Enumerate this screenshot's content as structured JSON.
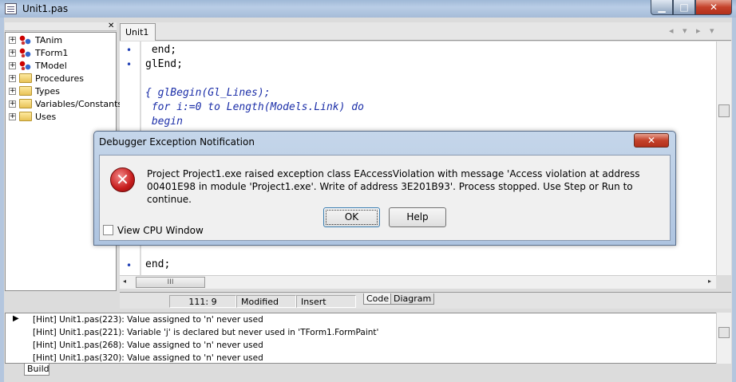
{
  "window": {
    "title": "Unit1.pas",
    "minimize": "▁",
    "maximize": "□",
    "close": "✕"
  },
  "tree": {
    "close_glyph": "✕",
    "items": [
      {
        "label": "TAnim",
        "icon": "class-icon",
        "expand": "+"
      },
      {
        "label": "TForm1",
        "icon": "class-icon",
        "expand": "+"
      },
      {
        "label": "TModel",
        "icon": "class-icon",
        "expand": "+"
      },
      {
        "label": "Procedures",
        "icon": "folder-icon",
        "expand": "+"
      },
      {
        "label": "Types",
        "icon": "folder-icon",
        "expand": "+"
      },
      {
        "label": "Variables/Constants",
        "icon": "folder-icon",
        "expand": "+"
      },
      {
        "label": "Uses",
        "icon": "folder-icon",
        "expand": "+"
      }
    ]
  },
  "editor": {
    "tab": "Unit1",
    "nav": "◂ ▾ ▸ ▾",
    "lines": [
      {
        "text": " end;",
        "comment": false,
        "dot": true
      },
      {
        "text": "glEnd;",
        "comment": false,
        "dot": true
      },
      {
        "text": "",
        "comment": false,
        "dot": false
      },
      {
        "text": "{ glBegin(Gl_Lines);",
        "comment": true,
        "dot": false
      },
      {
        "text": " for i:=0 to Length(Models.Link) do",
        "comment": true,
        "dot": false
      },
      {
        "text": " begin",
        "comment": true,
        "dot": false
      }
    ],
    "last_line": {
      "text": "end;",
      "dot": true
    },
    "hthumb": "III",
    "left_arrow": "◂",
    "right_arrow": "▸"
  },
  "status": {
    "position": "111:  9",
    "state": "Modified",
    "mode": "Insert",
    "tab_code": "Code",
    "tab_diagram": "Diagram"
  },
  "messages": {
    "arrow": "▶",
    "items": [
      "[Hint] Unit1.pas(223): Value assigned to 'n' never used",
      "[Hint] Unit1.pas(221): Variable 'j' is declared but never used in 'TForm1.FormPaint'",
      "[Hint] Unit1.pas(268): Value assigned to 'n' never used",
      "[Hint] Unit1.pas(320): Value assigned to 'n' never used"
    ],
    "tab": "Build"
  },
  "dialog": {
    "title": "Debugger Exception Notification",
    "close": "✕",
    "icon_glyph": "✕",
    "message": "Project Project1.exe raised exception class EAccessViolation with message 'Access violation at address 00401E98 in module 'Project1.exe'. Write of address 3E201B93'. Process stopped. Use Step or Run to continue.",
    "ok": "OK",
    "help": "Help",
    "checkbox_label": "View CPU Window",
    "checkbox_checked": false
  }
}
